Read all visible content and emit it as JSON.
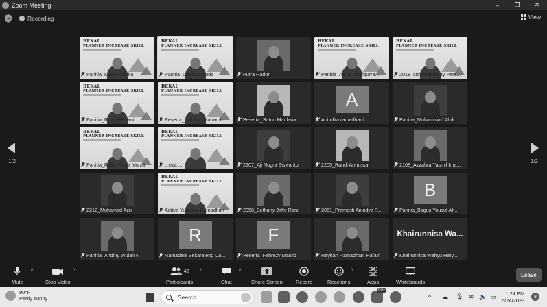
{
  "window": {
    "title": "Zoom Meeting",
    "controls": [
      "–",
      "❐",
      "✕"
    ]
  },
  "meeting_bar": {
    "recording_label": "Recording",
    "view_label": "View"
  },
  "gallery": {
    "page_indicator": "1/2",
    "tiles": [
      {
        "name": "Panitia_Kezia Rianka",
        "kind": "slide"
      },
      {
        "name": "Panitia_Louisa Aninda",
        "kind": "slide",
        "active": true
      },
      {
        "name": "Putra Radon",
        "kind": "video"
      },
      {
        "name": "Panitia_Azhar Taufiqurra...",
        "kind": "slide"
      },
      {
        "name": "2018_Novi Febrianty Para...",
        "kind": "slide"
      },
      {
        "name": "Panitia_Reza Hertiani",
        "kind": "slide"
      },
      {
        "name": "Peserta_Luthfiah Mabaroh",
        "kind": "slide"
      },
      {
        "name": "Peserta_Satrio Maulana",
        "kind": "video"
      },
      {
        "name": "Anindita ramadhani",
        "kind": "avatar",
        "letter": "A"
      },
      {
        "name": "Panitia_Muhammad Abdi...",
        "kind": "video"
      },
      {
        "name": "Panitia_Ridho Putra Muiza",
        "kind": "slide"
      },
      {
        "name": "...eza ...",
        "kind": "slide"
      },
      {
        "name": "2207_Aji Nugra Siswanto",
        "kind": "video"
      },
      {
        "name": "2205_Randi An-nissa",
        "kind": "video"
      },
      {
        "name": "2108_Azzahra Yasmil Ima...",
        "kind": "video"
      },
      {
        "name": "2212_Muhamad Azril",
        "kind": "video"
      },
      {
        "name": "Aditya Yudistira Ramadhan",
        "kind": "slide"
      },
      {
        "name": "2058_Bethany Jaffe Rani",
        "kind": "video"
      },
      {
        "name": "2061_Pramesti Anindya P...",
        "kind": "video"
      },
      {
        "name": "Panitia_Bagus Yousuf Ah...",
        "kind": "avatar",
        "letter": "B"
      },
      {
        "name": "Panitia_Andiny Wulan N",
        "kind": "video"
      },
      {
        "name": "Ramadani Sekarajeng Da...",
        "kind": "avatar",
        "letter": "R"
      },
      {
        "name": "Peserta_Fahrezy Maulid",
        "kind": "avatar",
        "letter": "F"
      },
      {
        "name": "Rayhan Ramadhani Hafair",
        "kind": "video"
      },
      {
        "name": "Khairunnisa Wahyu Hary...",
        "kind": "bigname",
        "display": "Khairunnisa  Wa..."
      }
    ],
    "slide_text": {
      "line1": "BEKAL",
      "line2": "PLANNER INCREASE SKILL"
    }
  },
  "toolbar": {
    "mute": "Mute",
    "stop_video": "Stop Video",
    "participants": "Participants",
    "participants_count": "42",
    "chat": "Chat",
    "share_screen": "Share Screen",
    "record": "Record",
    "reactions": "Reactions",
    "apps": "Apps",
    "whiteboards": "Whiteboards",
    "leave": "Leave"
  },
  "taskbar": {
    "temperature": "90°F",
    "condition": "Partly sunny",
    "search_label": "Search",
    "badge": "99+",
    "time": "1:24 PM",
    "date": "6/24/2023",
    "notifications": "8"
  }
}
